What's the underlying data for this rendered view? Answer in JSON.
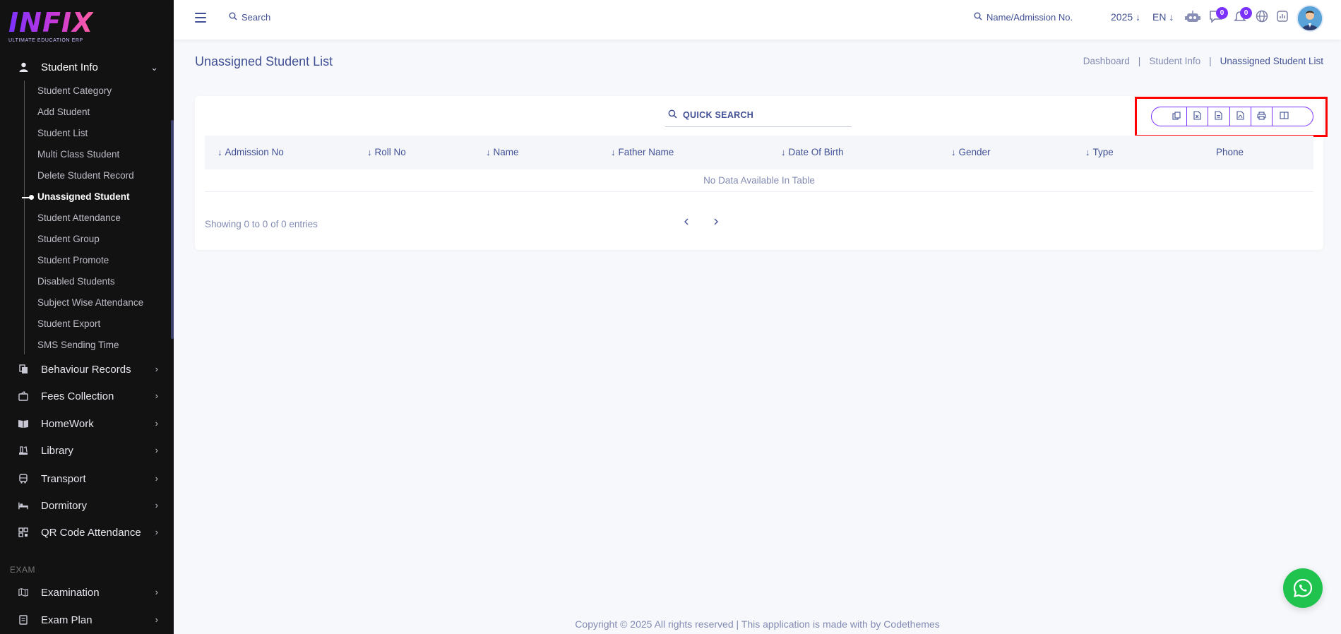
{
  "logo": {
    "word": "INFIX",
    "tagline": "ULTIMATE EDUCATION ERP"
  },
  "sidebar": {
    "student_info": {
      "label": "Student Info",
      "icon": "user-icon"
    },
    "sub_items": [
      {
        "label": "Student Category"
      },
      {
        "label": "Add Student"
      },
      {
        "label": "Student List"
      },
      {
        "label": "Multi Class Student"
      },
      {
        "label": "Delete Student Record"
      },
      {
        "label": "Unassigned Student",
        "active": true
      },
      {
        "label": "Student Attendance"
      },
      {
        "label": "Student Group"
      },
      {
        "label": "Student Promote"
      },
      {
        "label": "Disabled Students"
      },
      {
        "label": "Subject Wise Attendance"
      },
      {
        "label": "Student Export"
      },
      {
        "label": "SMS Sending Time"
      }
    ],
    "menus": [
      {
        "label": "Behaviour Records",
        "icon": "records-icon"
      },
      {
        "label": "Fees Collection",
        "icon": "fees-icon"
      },
      {
        "label": "HomeWork",
        "icon": "book-icon"
      },
      {
        "label": "Library",
        "icon": "library-icon"
      },
      {
        "label": "Transport",
        "icon": "bus-icon"
      },
      {
        "label": "Dormitory",
        "icon": "bed-icon"
      },
      {
        "label": "QR Code Attendance",
        "icon": "qr-code-icon"
      }
    ],
    "section_exam": "EXAM",
    "exam_menus": [
      {
        "label": "Examination",
        "icon": "map-icon"
      },
      {
        "label": "Exam Plan",
        "icon": "document-icon"
      }
    ]
  },
  "topbar": {
    "search_label": "Search",
    "admission_search_label": "Name/Admission No.",
    "year": "2025",
    "language": "EN",
    "chat_badge": "0",
    "notification_badge": "0"
  },
  "page": {
    "title": "Unassigned Student List",
    "breadcrumb": [
      "Dashboard",
      "Student Info",
      "Unassigned Student List"
    ],
    "breadcrumb_separator": "|"
  },
  "table": {
    "quick_search": "QUICK SEARCH",
    "columns": [
      {
        "label": "Admission No",
        "sortable": true
      },
      {
        "label": "Roll No",
        "sortable": true
      },
      {
        "label": "Name",
        "sortable": true
      },
      {
        "label": "Father Name",
        "sortable": true
      },
      {
        "label": "Date Of Birth",
        "sortable": true
      },
      {
        "label": "Gender",
        "sortable": true
      },
      {
        "label": "Type",
        "sortable": true
      },
      {
        "label": "Phone",
        "sortable": false
      }
    ],
    "empty_message": "No Data Available In Table",
    "showing": "Showing 0 to 0 of 0 entries",
    "export_buttons": [
      "copy-icon",
      "excel-icon",
      "csv-icon",
      "pdf-icon",
      "print-icon",
      "columns-icon"
    ]
  },
  "footer": {
    "text": "Copyright © 2025 All rights reserved | This application is made with by Codethemes"
  },
  "colors": {
    "accent": "#7c32ff",
    "primary_text": "#415094",
    "sidebar_bg": "#121212",
    "whatsapp": "#1fc34e",
    "highlight": "#ff0000"
  }
}
